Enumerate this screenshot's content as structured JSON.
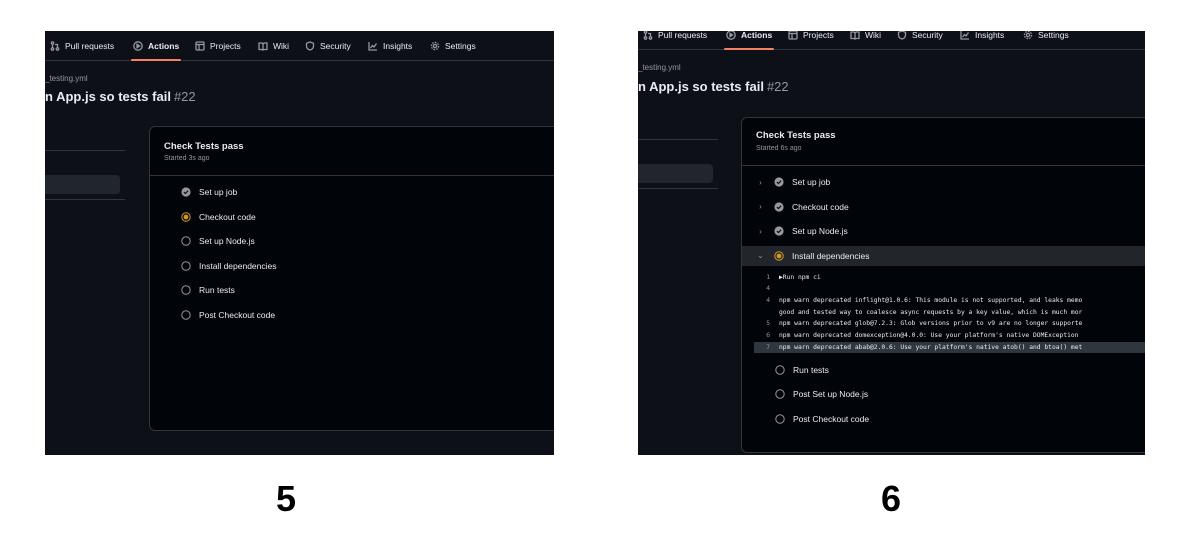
{
  "nav": {
    "tabs": [
      "Pull requests",
      "Actions",
      "Projects",
      "Wiki",
      "Security",
      "Insights",
      "Settings"
    ],
    "active": "Actions"
  },
  "screens": [
    {
      "caption": "5",
      "workflow_file": "_testing.yml",
      "run_title": "n App.js so tests fail",
      "run_number": "#22",
      "job": {
        "title": "Check Tests pass",
        "started": "Started 3s ago"
      },
      "steps": [
        {
          "label": "Set up job",
          "status": "success"
        },
        {
          "label": "Checkout code",
          "status": "in-progress"
        },
        {
          "label": "Set up Node.js",
          "status": "queued"
        },
        {
          "label": "Install dependencies",
          "status": "queued"
        },
        {
          "label": "Run tests",
          "status": "queued"
        },
        {
          "label": "Post Checkout code",
          "status": "queued"
        }
      ]
    },
    {
      "caption": "6",
      "workflow_file": "_testing.yml",
      "run_title": "n App.js so tests fail",
      "run_number": "#22",
      "job": {
        "title": "Check Tests pass",
        "started": "Started 6s ago"
      },
      "steps_before": [
        {
          "label": "Set up job",
          "status": "success"
        },
        {
          "label": "Checkout code",
          "status": "success"
        },
        {
          "label": "Set up Node.js",
          "status": "success"
        }
      ],
      "expanded_step": {
        "label": "Install dependencies",
        "status": "in-progress"
      },
      "log": [
        {
          "ln": "1",
          "text": "▶Run npm ci"
        },
        {
          "ln": "4",
          "text": ""
        },
        {
          "ln": "4",
          "text": "npm warn deprecated inflight@1.0.6: This module is not supported, and leaks memo"
        },
        {
          "ln": "",
          "text": "good and tested way to coalesce async requests by a key value, which is much mor"
        },
        {
          "ln": "5",
          "text": "npm warn deprecated glob@7.2.3: Glob versions prior to v9 are no longer supporte"
        },
        {
          "ln": "6",
          "text": "npm warn deprecated domexception@4.0.0: Use your platform's native DOMException"
        },
        {
          "ln": "7",
          "text": "npm warn deprecated abab@2.0.6: Use your platform's native atob() and btoa() met"
        }
      ],
      "steps_after": [
        {
          "label": "Run tests",
          "status": "queued"
        },
        {
          "label": "Post Set up Node.js",
          "status": "queued"
        },
        {
          "label": "Post Checkout code",
          "status": "queued"
        }
      ]
    }
  ],
  "colors": {
    "background": "#0d1117",
    "success": "#9198a1",
    "in_progress": "#d29922",
    "active_tab_underline": "#f78166"
  }
}
